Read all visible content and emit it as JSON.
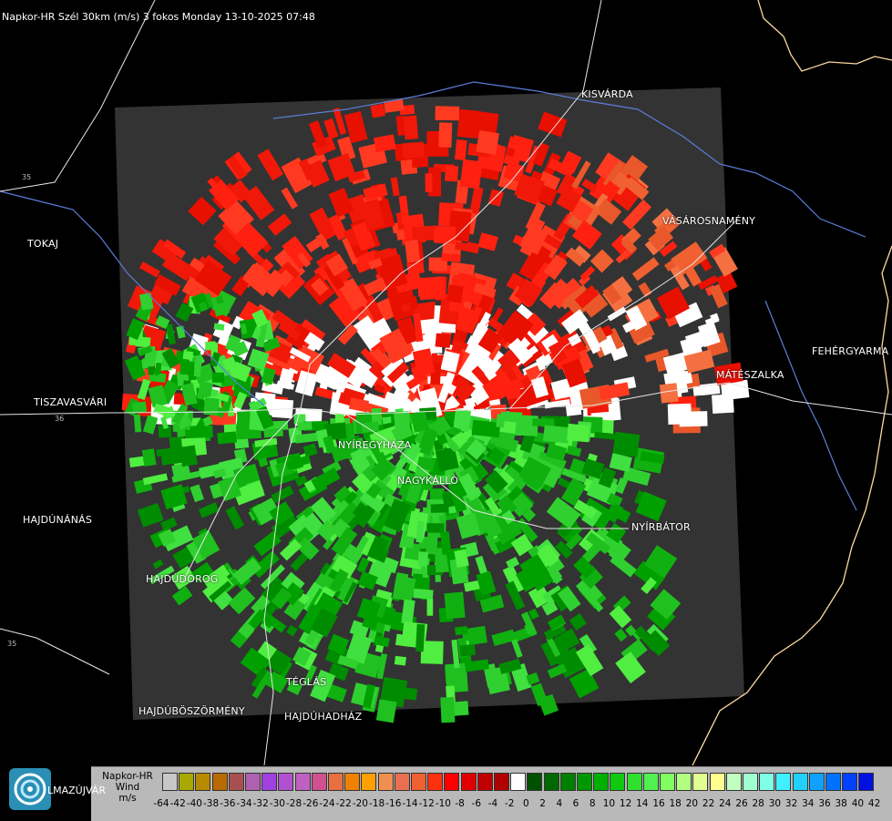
{
  "header": {
    "title": "Napkor-HR Szél 30km (m/s) 3 fokos Monday 13-10-2025 07:48"
  },
  "cities": [
    {
      "name": "KISVÁRDA",
      "id": "kisvarda"
    },
    {
      "name": "TOKAJ",
      "id": "tokaj"
    },
    {
      "name": "VÁSÁROSNAMÉNY",
      "id": "vasarosnameny"
    },
    {
      "name": "FEHÉRGYARMA",
      "id": "fehergyarmat"
    },
    {
      "name": "MÁTÉSZALKA",
      "id": "mateszalka"
    },
    {
      "name": "TISZAVASVÁRI",
      "id": "tiszavasvari"
    },
    {
      "name": "NYÍREGYHÁZA",
      "id": "nyiregyhaza"
    },
    {
      "name": "NAGYKÁLLÓ",
      "id": "nagykallo"
    },
    {
      "name": "HAJDÚNÁNÁS",
      "id": "hajdunanas"
    },
    {
      "name": "NYÍRBÁTOR",
      "id": "nyirbator"
    },
    {
      "name": "HAJDÚDOROG",
      "id": "hajdudorog"
    },
    {
      "name": "TÉGLÁS",
      "id": "teglas"
    },
    {
      "name": "HAJDÚBÖSZÖRMÉNY",
      "id": "hajduboszormeny"
    },
    {
      "name": "HAJDÚHADHÁZ",
      "id": "hajduhadhaz"
    },
    {
      "name": "LMAZÚJVÁR",
      "id": "balmazujvaros"
    }
  ],
  "routes": [
    "35",
    "36",
    "35"
  ],
  "legend": {
    "line1": "Napkor-HR",
    "line2": "Wind",
    "line3": "m/s",
    "ticks": [
      "-64",
      "-42",
      "-40",
      "-38",
      "-36",
      "-34",
      "-32",
      "-30",
      "-28",
      "-26",
      "-24",
      "-22",
      "-20",
      "-18",
      "-16",
      "-14",
      "-12",
      "-10",
      "-8",
      "-6",
      "-4",
      "-2",
      "0",
      "2",
      "4",
      "6",
      "8",
      "10",
      "12",
      "14",
      "16",
      "18",
      "20",
      "22",
      "24",
      "26",
      "28",
      "30",
      "32",
      "34",
      "36",
      "38",
      "40",
      "42"
    ],
    "colors": [
      "#c8c8c8",
      "#a8a800",
      "#b88a00",
      "#b86a00",
      "#a85050",
      "#b060b0",
      "#a040e0",
      "#b050d0",
      "#c060c0",
      "#d05090",
      "#e87040",
      "#f08000",
      "#ffa000",
      "#f09050",
      "#e87050",
      "#f06030",
      "#ff3010",
      "#ff0000",
      "#e00000",
      "#c00000",
      "#b00000",
      "#ffffff",
      "#005000",
      "#006800",
      "#008000",
      "#009800",
      "#00b000",
      "#10c810",
      "#30e030",
      "#50f050",
      "#80ff60",
      "#b0ff80",
      "#e0ff90",
      "#ffff90",
      "#c0ffc0",
      "#a0ffd0",
      "#80ffe8",
      "#40f0ff",
      "#20d0ff",
      "#10a0ff",
      "#0070ff",
      "#0040ff",
      "#0010e0"
    ]
  },
  "colors": {
    "background": "#000000",
    "radar_area": "#333333",
    "approaching": "#ff2010",
    "receding": "#20c020",
    "border_line": "#ffd9a0",
    "river_line": "#5a7fd8"
  },
  "logo": {
    "name": "napkor-logo-icon"
  }
}
